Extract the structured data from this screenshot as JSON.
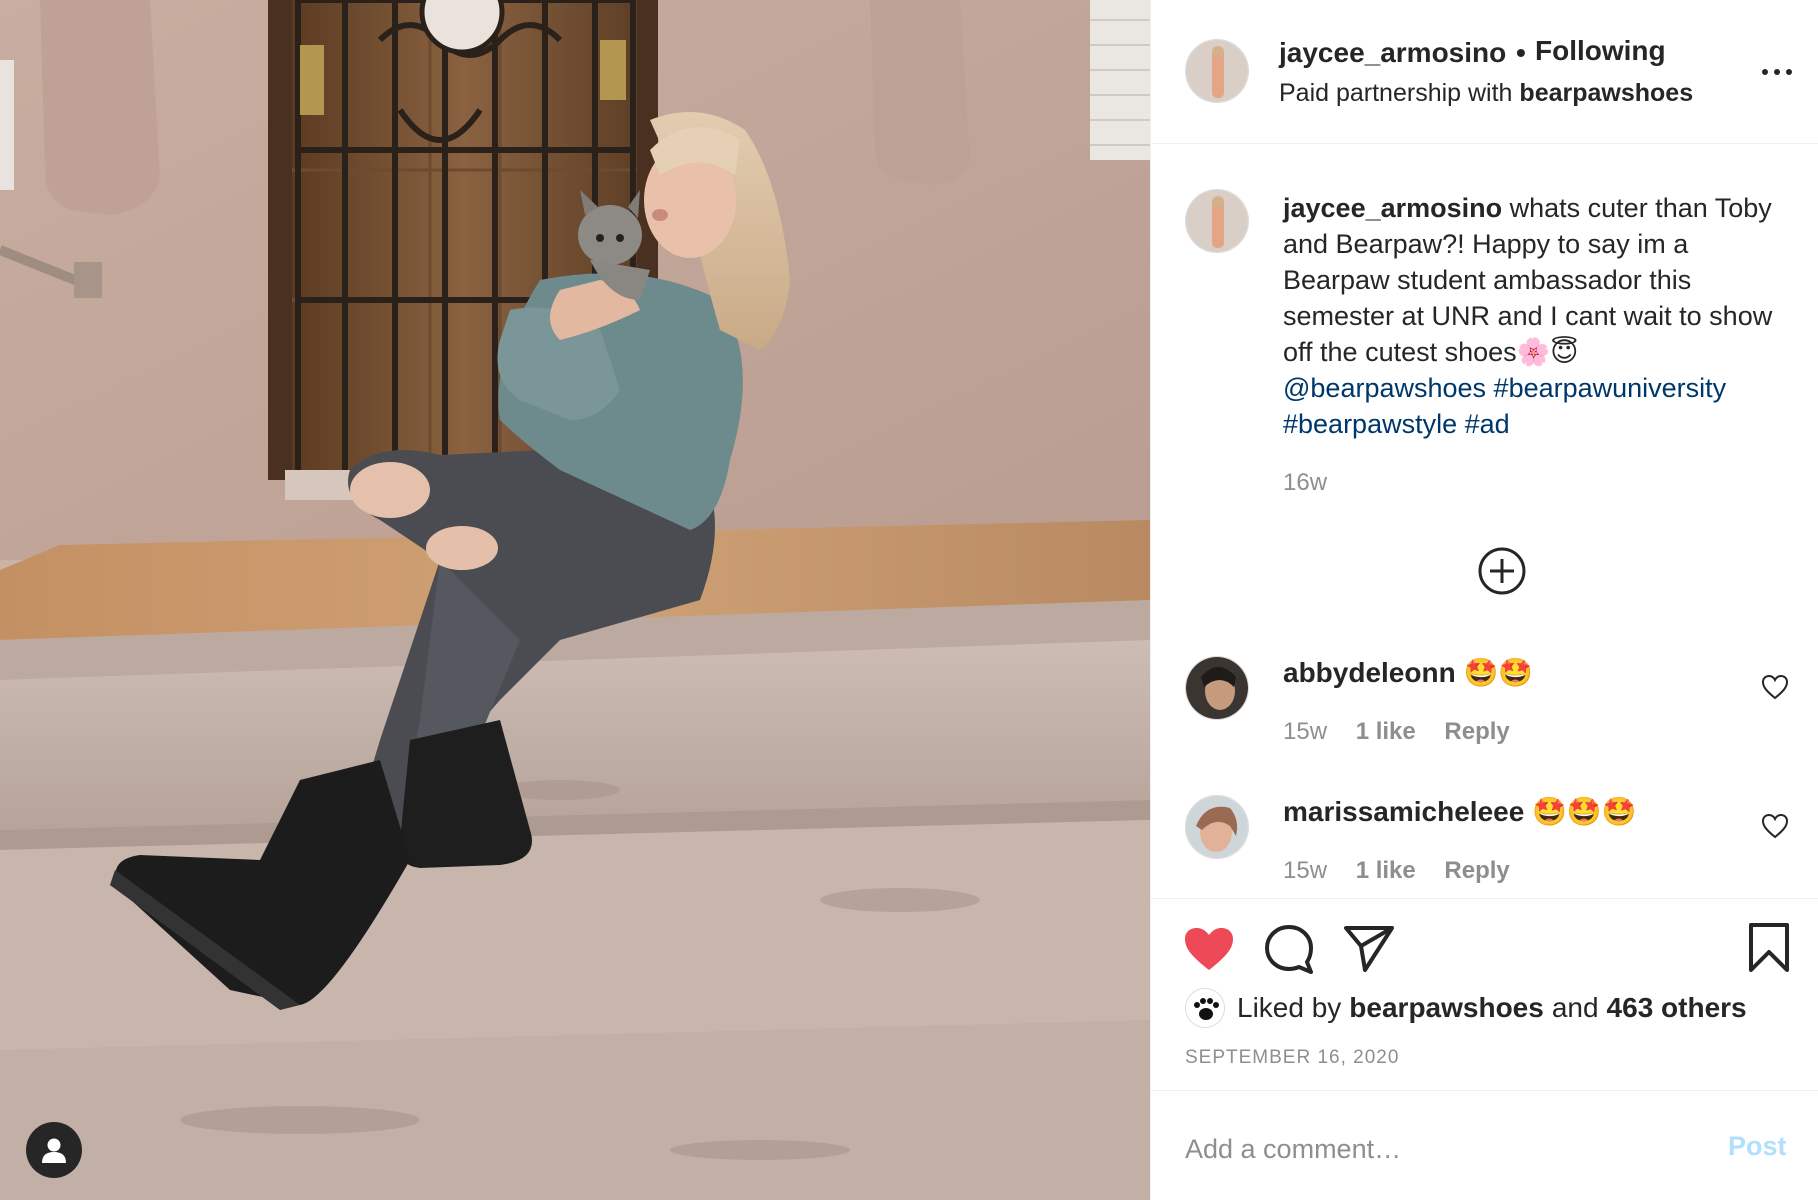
{
  "post": {
    "author": "jaycee_armosino",
    "follow_state": "Following",
    "separator": "•",
    "partnership_prefix": "Paid partnership with",
    "partner": "bearpawshoes"
  },
  "caption": {
    "username": "jaycee_armosino",
    "text": " whats cuter than Toby and Bearpaw?! Happy to say im a Bearpaw student ambassador this semester at UNR and I cant wait to show off the cutest shoes🌸😇",
    "mention": "@bearpawshoes",
    "hashtags": [
      "#bearpawuniversity",
      "#bearpawstyle",
      "#ad"
    ],
    "time": "16w"
  },
  "comments": [
    {
      "username": "abbydeleonn",
      "emoji": "🤩🤩",
      "time": "15w",
      "likes": "1 like",
      "reply": "Reply"
    },
    {
      "username": "marissamicheleee",
      "emoji": "🤩🤩🤩",
      "time": "15w",
      "likes": "1 like",
      "reply": "Reply"
    }
  ],
  "likes": {
    "prefix": "Liked by",
    "user": "bearpawshoes",
    "middle": "and",
    "others": "463 others"
  },
  "date": "SEPTEMBER 16, 2020",
  "comment_box": {
    "placeholder": "Add a comment…",
    "post_label": "Post"
  },
  "colors": {
    "liked_heart": "#ed4956",
    "link": "#00376b",
    "muted": "#8e8e8e",
    "post_disabled": "#b2dffc"
  },
  "icons": {
    "more": "ellipsis-icon",
    "load_more": "plus-circle-icon",
    "like": "heart-filled-icon",
    "comment": "speech-bubble-icon",
    "share": "paper-plane-icon",
    "save": "bookmark-icon",
    "tag": "user-tag-icon"
  }
}
